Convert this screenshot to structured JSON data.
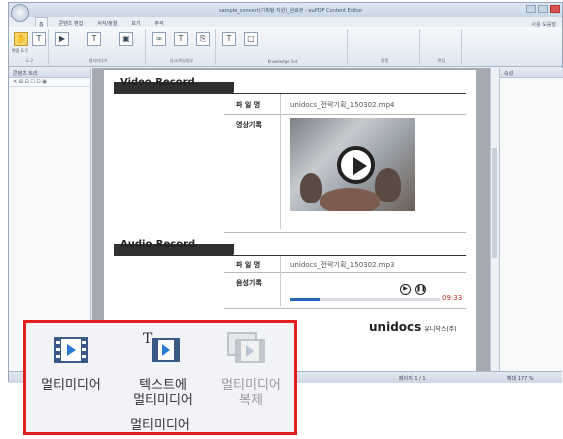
{
  "window": {
    "title": "sample_convert(기획팀 지원)_완료본 - euPDF Content Editor",
    "tabs": [
      "홈",
      "콘텐츠 편집",
      "서식/정렬",
      "보기",
      "주석"
    ],
    "help": "사용 도움말"
  },
  "ribbon": {
    "groups": [
      "도구",
      "멀티미디어",
      "링크/파일첨부",
      "Knowledge Set",
      "정렬",
      "편집"
    ],
    "items": [
      "편집 도구",
      "텍스트 도구",
      "멀티미디어",
      "텍스트에 멀티미디어",
      "멀티미디어 복제",
      "링크",
      "텍스트 링크",
      "파일 첨부",
      "텍스트영역",
      "사각형"
    ]
  },
  "left_panel": {
    "title": "콘텐츠 트리"
  },
  "right_panel": {
    "title": "속성"
  },
  "document": {
    "video_section": {
      "title": "Video Record",
      "filename_label": "파 일 명",
      "filename_value": "unidocs_전략기획_150302.mp4",
      "record_label": "영상기록"
    },
    "audio_section": {
      "title": "Audio Record",
      "filename_label": "파 일 명",
      "filename_value": "unidocs_전략기획_150302.mp3",
      "record_label": "음성기록",
      "time": "09:33",
      "progress": 0.2
    },
    "logo": {
      "brand": "unidocs",
      "sub": "유니닥스(주)"
    }
  },
  "statusbar": {
    "page": "페이지 1 / 1",
    "zoom": "확대 177 %"
  },
  "callout": {
    "items": [
      {
        "label": "멀티미디어",
        "icon": "multimedia-film-icon",
        "enabled": true
      },
      {
        "label": "텍스트에\n멀티미디어",
        "icon": "text-multimedia-icon",
        "enabled": true
      },
      {
        "label": "멀티미디어\n복제",
        "icon": "multimedia-copy-icon",
        "enabled": false
      }
    ],
    "group_label": "멀티미디어"
  },
  "colors": {
    "accent_red": "#e02020",
    "time_red": "#c0392b",
    "progress_blue": "#2467b5"
  }
}
